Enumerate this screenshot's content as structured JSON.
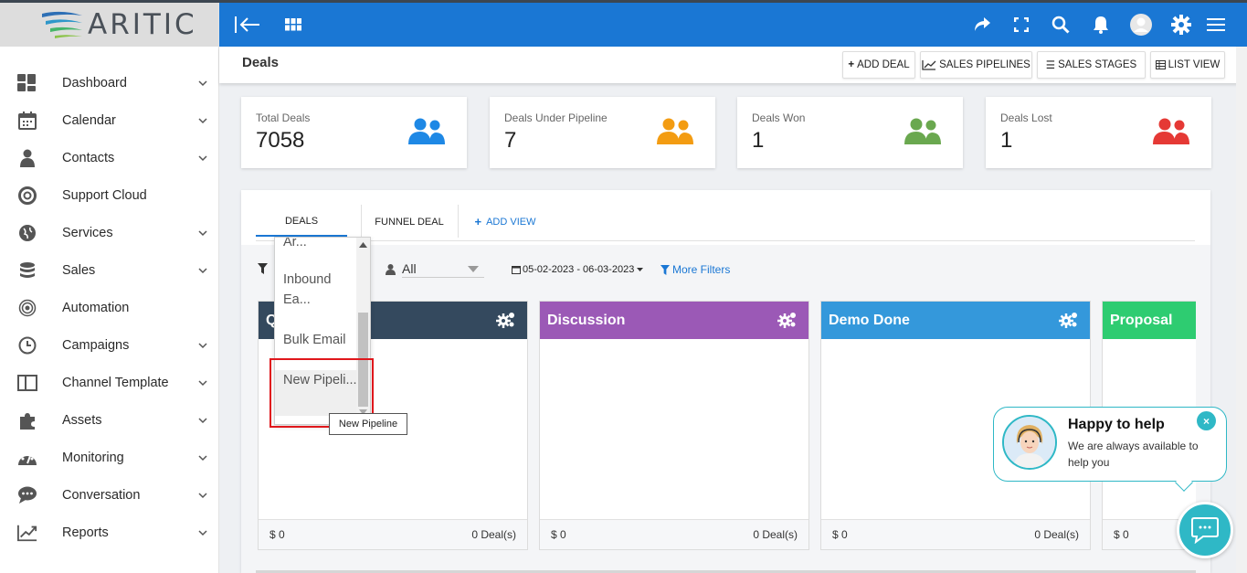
{
  "app": {
    "logo_text": "ARITIC"
  },
  "sidebar": {
    "items": [
      {
        "label": "Dashboard",
        "icon": "dashboard-icon",
        "has_caret": true
      },
      {
        "label": "Calendar",
        "icon": "calendar-icon",
        "has_caret": true
      },
      {
        "label": "Contacts",
        "icon": "contacts-icon",
        "has_caret": true
      },
      {
        "label": "Support Cloud",
        "icon": "support-icon",
        "has_caret": false
      },
      {
        "label": "Services",
        "icon": "services-icon",
        "has_caret": true
      },
      {
        "label": "Sales",
        "icon": "sales-icon",
        "has_caret": true
      },
      {
        "label": "Automation",
        "icon": "automation-icon",
        "has_caret": false
      },
      {
        "label": "Campaigns",
        "icon": "campaigns-icon",
        "has_caret": true
      },
      {
        "label": "Channel Template",
        "icon": "channel-template-icon",
        "has_caret": true
      },
      {
        "label": "Assets",
        "icon": "assets-icon",
        "has_caret": true
      },
      {
        "label": "Monitoring",
        "icon": "monitoring-icon",
        "has_caret": true
      },
      {
        "label": "Conversation",
        "icon": "conversation-icon",
        "has_caret": true
      },
      {
        "label": "Reports",
        "icon": "reports-icon",
        "has_caret": true
      }
    ]
  },
  "header": {
    "title": "Deals",
    "buttons": {
      "add_deal": "ADD DEAL",
      "sales_pipelines": "SALES PIPELINES",
      "sales_stages": "SALES STAGES",
      "list_view": "LIST VIEW"
    }
  },
  "stats": [
    {
      "label": "Total Deals",
      "value": "7058",
      "color": "#1e88e5"
    },
    {
      "label": "Deals Under Pipeline",
      "value": "7",
      "color": "#f39c12"
    },
    {
      "label": "Deals Won",
      "value": "1",
      "color": "#6aa84f"
    },
    {
      "label": "Deals Lost",
      "value": "1",
      "color": "#e53935"
    }
  ],
  "tabs": {
    "deals": "DEALS",
    "funnel": "FUNNEL DEAL",
    "add_view": "ADD VIEW"
  },
  "filters": {
    "owner": "All",
    "date_range": "05-02-2023 - 06-03-2023",
    "more_filters": "More Filters"
  },
  "pipeline_dropdown": {
    "items": [
      "Ar...",
      "Inbound Ea...",
      "Bulk Email",
      "New Pipeli..."
    ],
    "tooltip": "New Pipeline"
  },
  "columns": [
    {
      "title": "Q",
      "color": "#34495e",
      "amount": "$ 0",
      "deals": "0 Deal(s)"
    },
    {
      "title": "Discussion",
      "color": "#9b59b6",
      "amount": "$ 0",
      "deals": "0 Deal(s)"
    },
    {
      "title": "Demo Done",
      "color": "#3498db",
      "amount": "$ 0",
      "deals": "0 Deal(s)"
    },
    {
      "title": "Proposal",
      "color": "#2ecc71",
      "amount": "$ 0",
      "deals": ""
    }
  ],
  "chat": {
    "title": "Happy to help",
    "subtitle": "We are always available to help you",
    "close": "×",
    "accent": "#2fb8c6"
  }
}
